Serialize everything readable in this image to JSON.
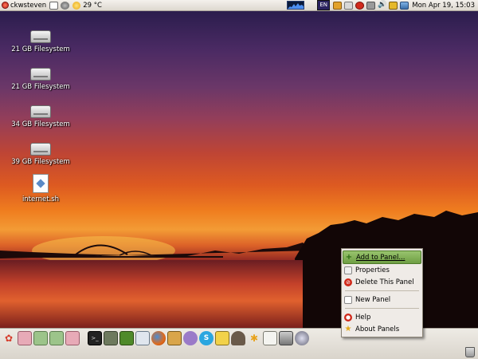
{
  "top_panel": {
    "user_menu": "ckwsteven",
    "weather": "29 °C",
    "clock": "Mon Apr 19, 15:03",
    "keyboard_layout": "EN"
  },
  "desktop": {
    "icons": [
      {
        "label": "21 GB Filesystem",
        "icon": "drive-icon"
      },
      {
        "label": "21 GB Filesystem",
        "icon": "drive-icon"
      },
      {
        "label": "34 GB Filesystem",
        "icon": "drive-icon"
      },
      {
        "label": "39 GB Filesystem",
        "icon": "drive-icon"
      },
      {
        "label": "internet.sh",
        "icon": "script-file-icon"
      }
    ]
  },
  "context_menu": {
    "items": [
      {
        "label": "Add to Panel...",
        "icon": "add-icon"
      },
      {
        "label": "Properties",
        "icon": "properties-icon"
      },
      {
        "label": "Delete This Panel",
        "icon": "delete-icon"
      },
      {
        "label": "New Panel",
        "icon": "new-panel-icon"
      },
      {
        "label": "Help",
        "icon": "help-icon"
      },
      {
        "label": "About Panels",
        "icon": "about-icon"
      }
    ]
  },
  "colors": {
    "menu_highlight": "#7fae52",
    "panel_bg": "#e8e4dd"
  }
}
